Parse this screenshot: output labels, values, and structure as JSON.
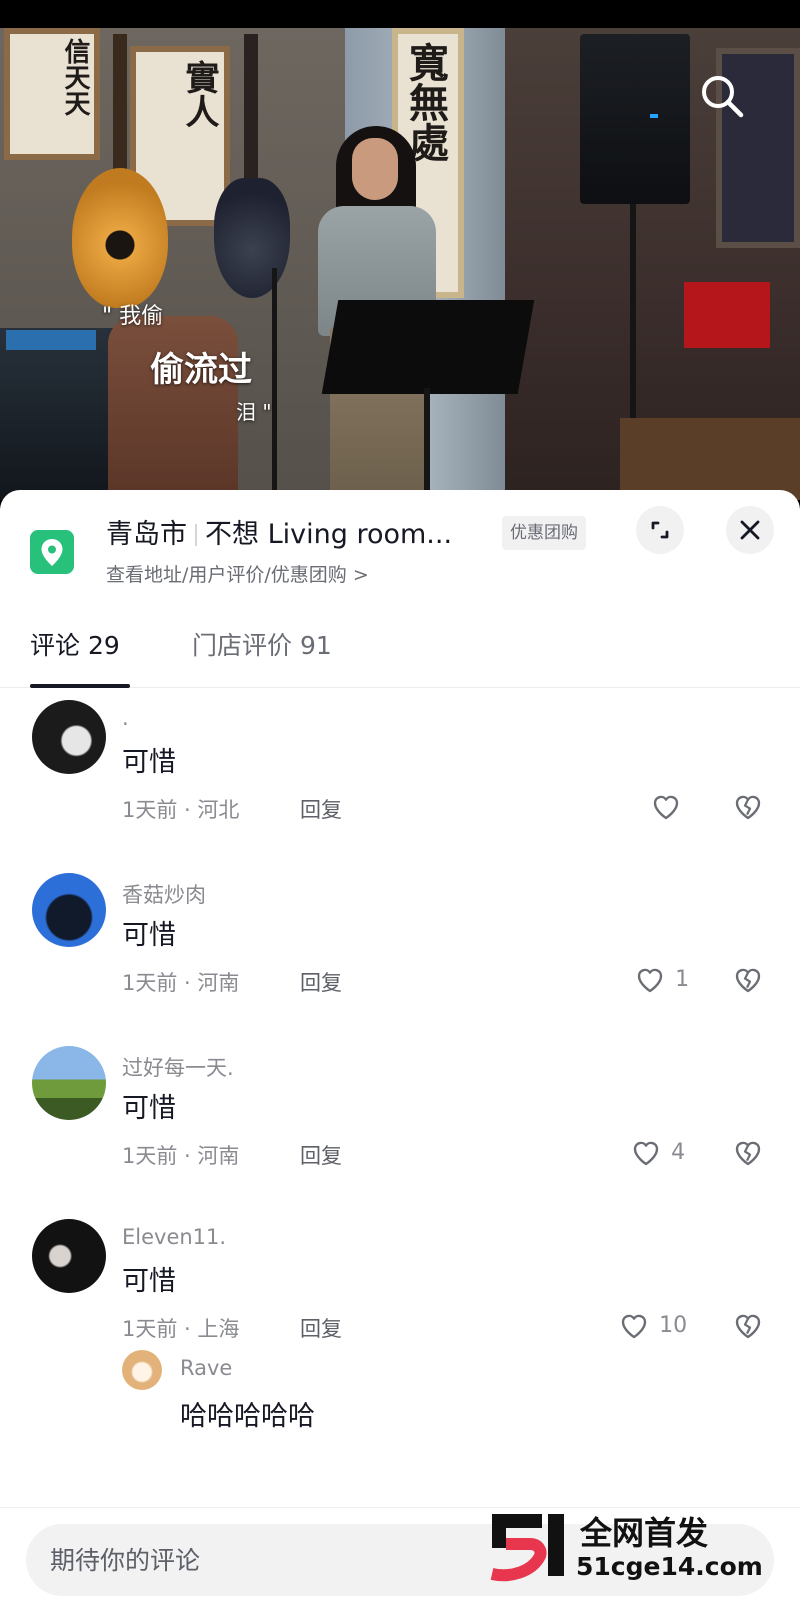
{
  "video": {
    "lyrics": [
      "\" 我偷",
      "偷流过",
      "泪 \""
    ]
  },
  "poi": {
    "city": "青岛市",
    "name": "不想 Living room...",
    "subtitle": "查看地址/用户评价/优惠团购 >",
    "deal_badge": "优惠团购"
  },
  "tabs": [
    {
      "label": "评论 29",
      "active": true
    },
    {
      "label": "门店评价 91",
      "active": false
    }
  ],
  "comments": [
    {
      "name": ".",
      "text": "可惜",
      "meta": "1天前 · 河北",
      "reply_label": "回复",
      "likes": ""
    },
    {
      "name": "香菇炒肉",
      "text": "可惜",
      "meta": "1天前 · 河南",
      "reply_label": "回复",
      "likes": "1"
    },
    {
      "name": "过好每一天.",
      "text": "可惜",
      "meta": "1天前 · 河南",
      "reply_label": "回复",
      "likes": "4"
    },
    {
      "name": "Eleven11.",
      "text": "可惜",
      "meta": "1天前 · 上海",
      "reply_label": "回复",
      "likes": "10"
    }
  ],
  "sub_reply": {
    "name": "Rave",
    "text": "哈哈哈哈哈"
  },
  "composer": {
    "placeholder": "期待你的评论"
  },
  "watermark": {
    "line1": "全网首发",
    "line2": "51cge14.com"
  },
  "colors": {
    "pin": "#27c17c",
    "text_primary": "#161823",
    "text_secondary": "#8a8b91",
    "watermark_red": "#e8364f"
  }
}
